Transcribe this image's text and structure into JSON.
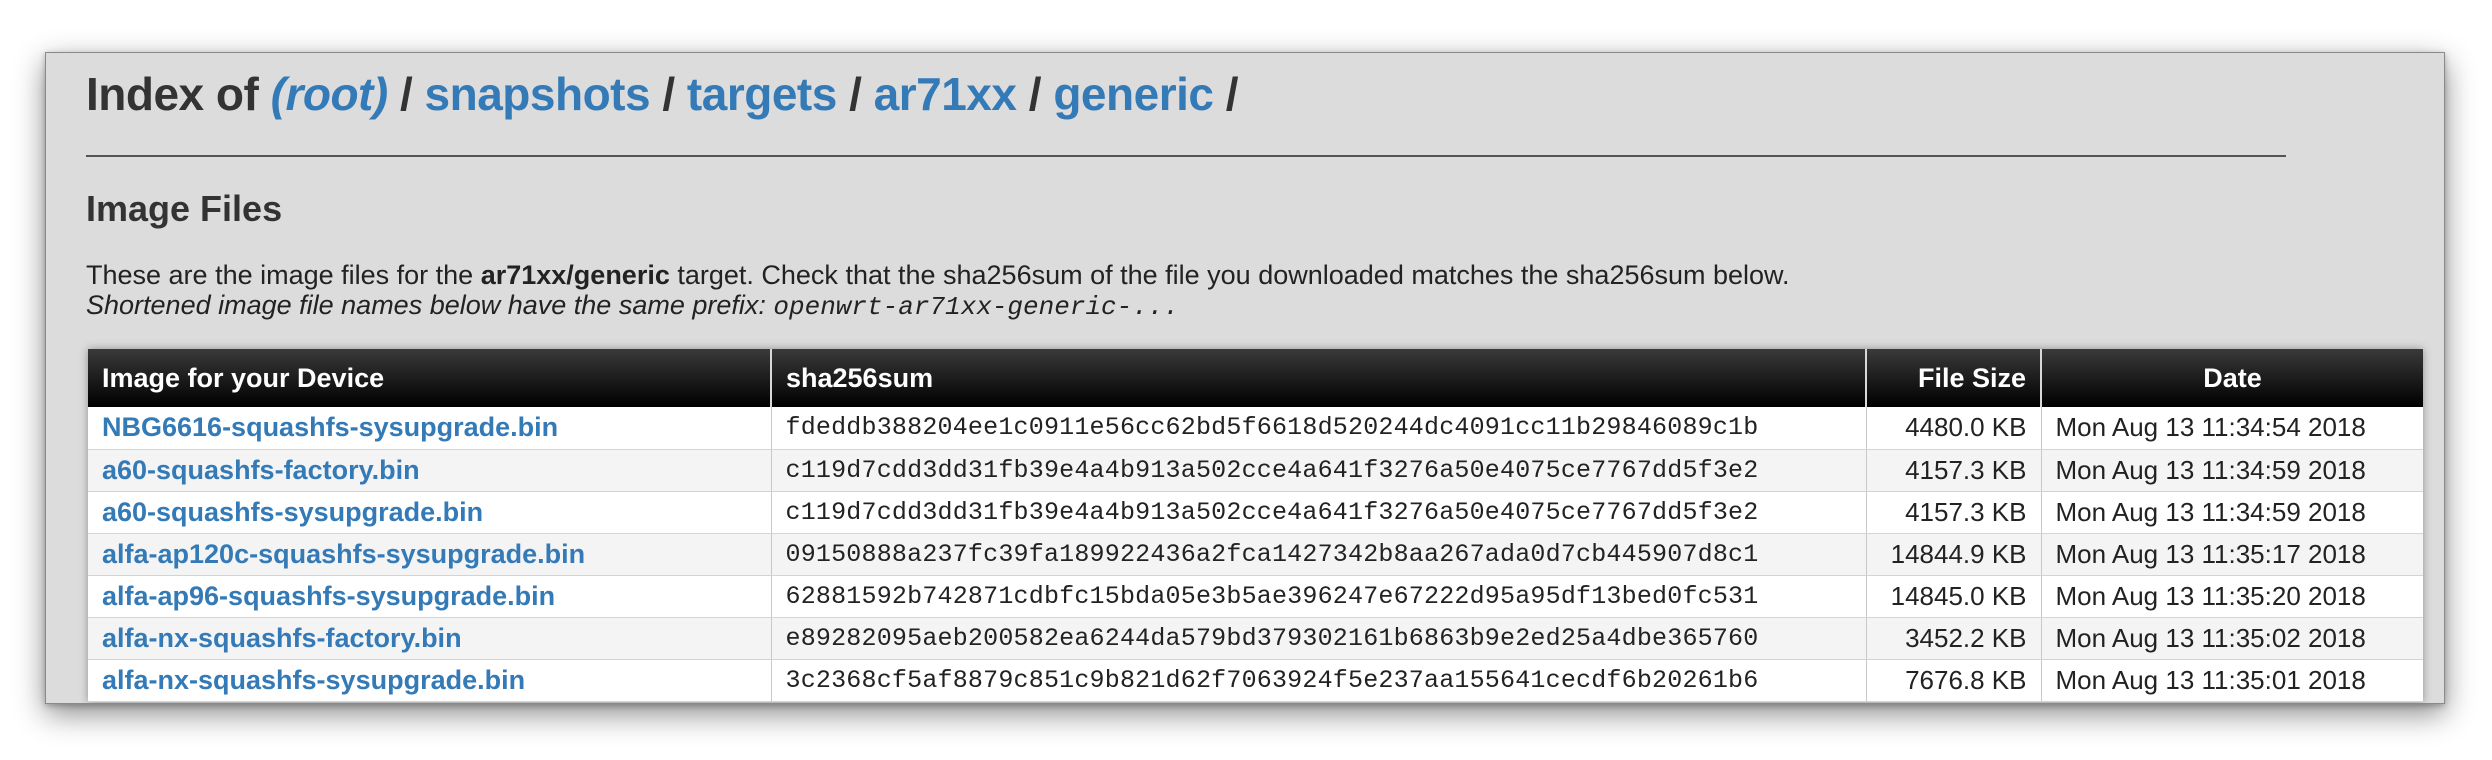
{
  "header": {
    "prefix": "Index of",
    "breadcrumbs": [
      {
        "label": "(root)",
        "italic": true
      },
      {
        "label": "snapshots"
      },
      {
        "label": "targets"
      },
      {
        "label": "ar71xx"
      },
      {
        "label": "generic"
      }
    ],
    "separator": "/"
  },
  "section": {
    "title": "Image Files"
  },
  "description": {
    "line1_before": "These are the image files for the ",
    "line1_target": "ar71xx/generic",
    "line1_after": " target. Check that the sha256sum of the file you downloaded matches the sha256sum below.",
    "line2_text": "Shortened image file names below have the same prefix: ",
    "line2_prefix": "openwrt-ar71xx-generic-..."
  },
  "table": {
    "columns": {
      "name": "Image for your Device",
      "sha": "sha256sum",
      "size": "File Size",
      "date": "Date"
    },
    "rows": [
      {
        "name": "NBG6616-squashfs-sysupgrade.bin",
        "sha": "fdeddb388204ee1c0911e56cc62bd5f6618d520244dc4091cc11b29846089c1b",
        "size": "4480.0 KB",
        "date": "Mon Aug 13 11:34:54 2018"
      },
      {
        "name": "a60-squashfs-factory.bin",
        "sha": "c119d7cdd3dd31fb39e4a4b913a502cce4a641f3276a50e4075ce7767dd5f3e2",
        "size": "4157.3 KB",
        "date": "Mon Aug 13 11:34:59 2018"
      },
      {
        "name": "a60-squashfs-sysupgrade.bin",
        "sha": "c119d7cdd3dd31fb39e4a4b913a502cce4a641f3276a50e4075ce7767dd5f3e2",
        "size": "4157.3 KB",
        "date": "Mon Aug 13 11:34:59 2018"
      },
      {
        "name": "alfa-ap120c-squashfs-sysupgrade.bin",
        "sha": "09150888a237fc39fa189922436a2fca1427342b8aa267ada0d7cb445907d8c1",
        "size": "14844.9 KB",
        "date": "Mon Aug 13 11:35:17 2018"
      },
      {
        "name": "alfa-ap96-squashfs-sysupgrade.bin",
        "sha": "62881592b742871cdbfc15bda05e3b5ae396247e67222d95a95df13bed0fc531",
        "size": "14845.0 KB",
        "date": "Mon Aug 13 11:35:20 2018"
      },
      {
        "name": "alfa-nx-squashfs-factory.bin",
        "sha": "e89282095aeb200582ea6244da579bd379302161b6863b9e2ed25a4dbe365760",
        "size": "3452.2 KB",
        "date": "Mon Aug 13 11:35:02 2018"
      },
      {
        "name": "alfa-nx-squashfs-sysupgrade.bin",
        "sha": "3c2368cf5af8879c851c9b821d62f7063924f5e237aa155641cecdf6b20261b6",
        "size": "7676.8 KB",
        "date": "Mon Aug 13 11:35:01 2018"
      }
    ]
  },
  "colors": {
    "link": "#337ab7",
    "page_background": "#dcdcdc",
    "header_row": "#000000"
  }
}
